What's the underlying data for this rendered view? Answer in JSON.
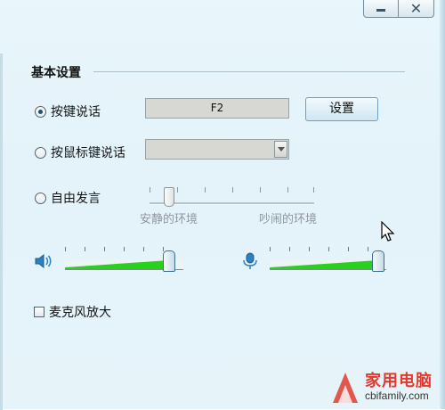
{
  "window": {
    "title_buttons": {
      "minimize_icon": "minimize-icon",
      "close_icon": "close-icon",
      "close_glyph": "✕"
    }
  },
  "section": {
    "title": "基本设置"
  },
  "push_to_talk": {
    "label": "按键说话",
    "selected": true,
    "hotkey_value": "F2",
    "set_button_label": "设置"
  },
  "mouse_key_talk": {
    "label": "按鼠标键说话",
    "selected": false,
    "selected_value": ""
  },
  "free_talk": {
    "label": "自由发言",
    "selected": false,
    "environment_slider": {
      "min_label": "安静的环境",
      "max_label": "吵闹的环境",
      "level": 0.12
    }
  },
  "volume": {
    "speaker_icon": "speaker-icon",
    "speaker_level": 0.88,
    "mic_icon": "microphone-icon",
    "mic_level": 0.93,
    "fill_color": "#28d11c"
  },
  "mic_boost": {
    "label": "麦克风放大",
    "checked": false
  },
  "watermark": {
    "brand": "家用电脑",
    "site": "cbifamily.com"
  }
}
